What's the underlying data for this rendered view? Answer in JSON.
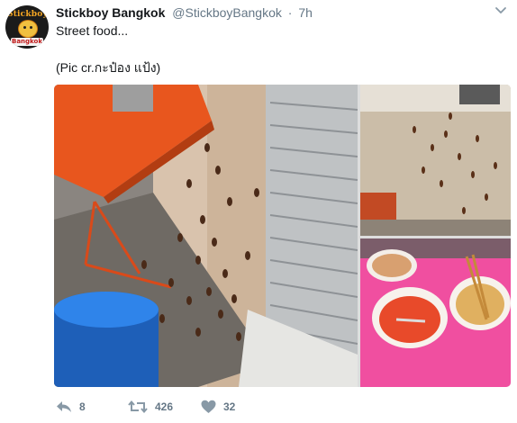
{
  "tweet": {
    "avatar": {
      "logo_top": "Stickboy",
      "logo_bottom": "Bangkok"
    },
    "display_name": "Stickboy Bangkok",
    "handle": "@StickboyBangkok",
    "separator": "·",
    "time": "7h",
    "text_line1": "Street food...",
    "text_line2": "(Pic cr.กะป๋อง แป้ง)"
  },
  "actions": {
    "reply_count": "8",
    "retweet_count": "426",
    "like_count": "32"
  },
  "icons": {
    "reply": "reply-icon",
    "retweet": "retweet-icon",
    "like": "heart-icon",
    "menu": "chevron-down-icon"
  },
  "colors": {
    "name": "#14171a",
    "meta": "#657786",
    "icon": "#8899a6",
    "table_orange": "#e8561e",
    "table_pink": "#f04fa0",
    "stool_blue": "#1a6fd6"
  }
}
